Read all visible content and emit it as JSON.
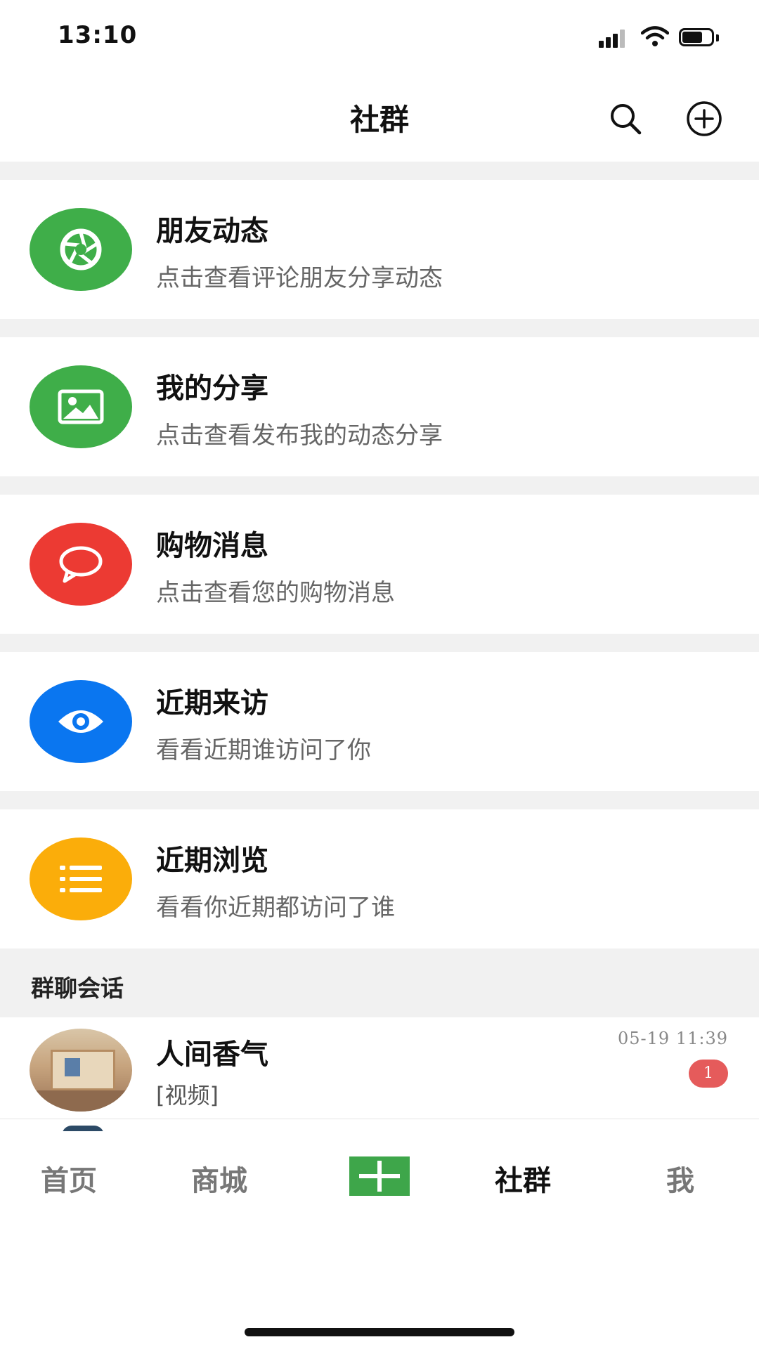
{
  "status_bar": {
    "time": "13:10"
  },
  "nav": {
    "title": "社群"
  },
  "entries": [
    {
      "title": "朋友动态",
      "subtitle": "点击查看评论朋友分享动态",
      "icon": "aperture-icon",
      "color": "#3fae49"
    },
    {
      "title": "我的分享",
      "subtitle": "点击查看发布我的动态分享",
      "icon": "image-icon",
      "color": "#3fae49"
    },
    {
      "title": "购物消息",
      "subtitle": "点击查看您的购物消息",
      "icon": "chat-bubble-icon",
      "color": "#ec3a33"
    },
    {
      "title": "近期来访",
      "subtitle": "看看近期谁访问了你",
      "icon": "eye-icon",
      "color": "#0a76f0"
    },
    {
      "title": "近期浏览",
      "subtitle": "看看你近期都访问了谁",
      "icon": "list-icon",
      "color": "#fbad0a"
    }
  ],
  "section": {
    "title": "群聊会话"
  },
  "chats": [
    {
      "name": "人间香气",
      "last_message": "[视频]",
      "time": "05-19 11:39",
      "unread": "1"
    }
  ],
  "tabs": [
    {
      "label": "首页",
      "active": false
    },
    {
      "label": "商城",
      "active": false
    },
    {
      "label": "+",
      "active": false,
      "icon": "plus-icon"
    },
    {
      "label": "社群",
      "active": true
    },
    {
      "label": "我",
      "active": false
    }
  ],
  "colors": {
    "accent_green": "#3ea64a",
    "badge_red": "#e55b5b",
    "divider": "#f1f1f1"
  }
}
